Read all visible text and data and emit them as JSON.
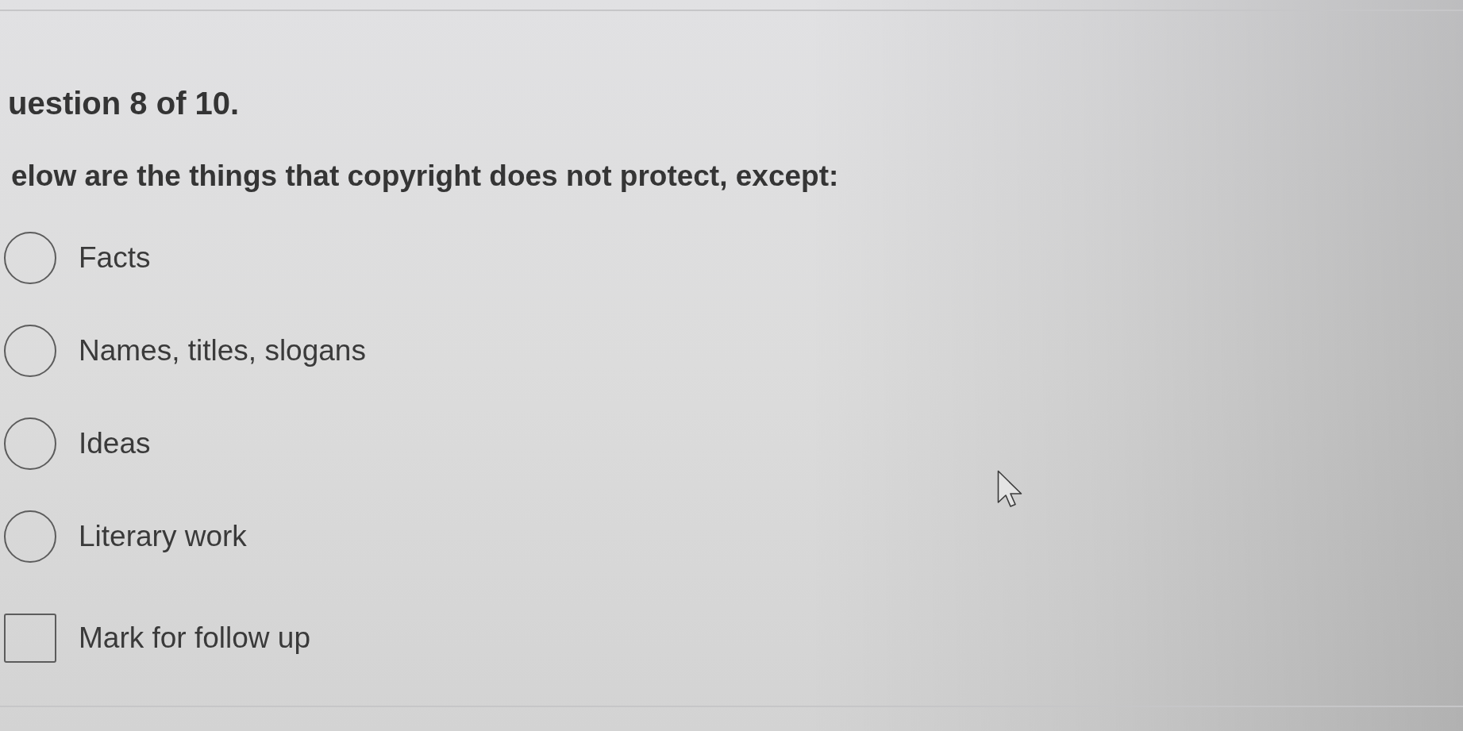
{
  "header": {
    "progress": "uestion 8 of 10."
  },
  "question": {
    "prompt": "elow are the things that copyright does not protect, except:"
  },
  "options": [
    {
      "label": "Facts",
      "selected": false
    },
    {
      "label": "Names, titles, slogans",
      "selected": false
    },
    {
      "label": "Ideas",
      "selected": false
    },
    {
      "label": "Literary work",
      "selected": false
    }
  ],
  "follow_up": {
    "label": "Mark for follow up",
    "checked": false
  }
}
